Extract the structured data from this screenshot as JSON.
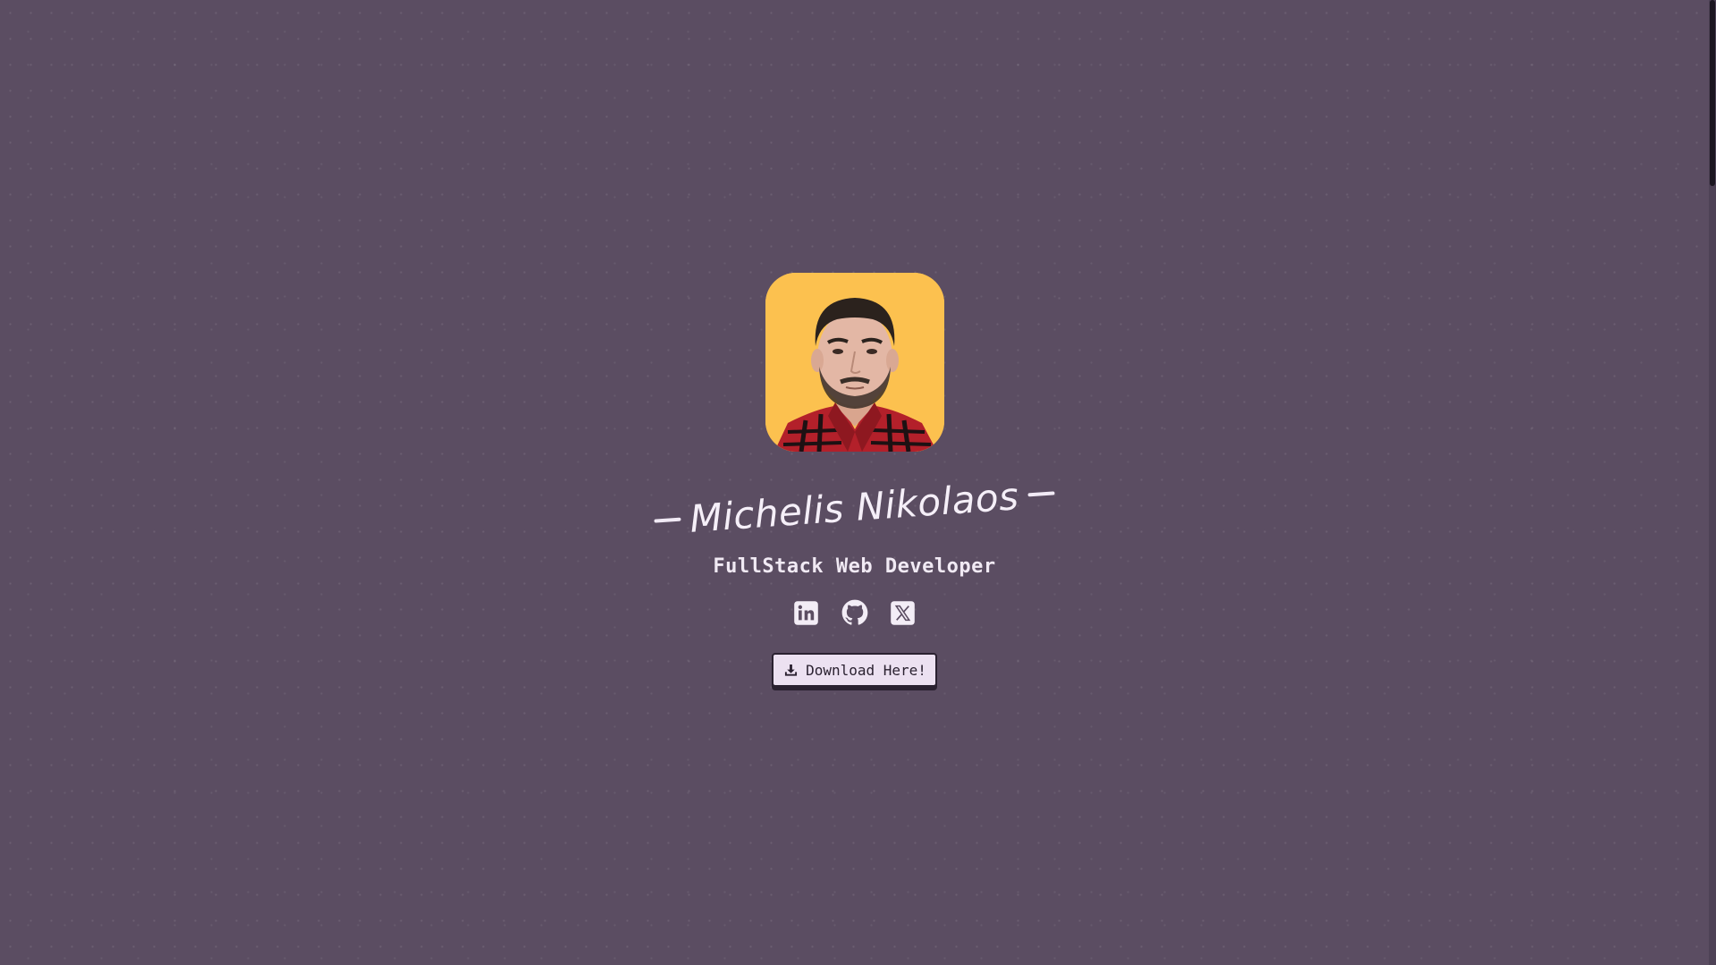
{
  "profile": {
    "name": "Michelis Nikolaos",
    "role": "FullStack Web Developer"
  },
  "socials": [
    {
      "icon": "linkedin-icon"
    },
    {
      "icon": "github-icon"
    },
    {
      "icon": "x-twitter-icon"
    }
  ],
  "download": {
    "label": "Download Here!",
    "icon": "download-icon"
  },
  "colors": {
    "background": "#5b4d62",
    "avatar_bg": "#fcc14f",
    "text": "#f5eff8",
    "button_bg": "#ece1f1",
    "button_border": "#2a2130"
  }
}
